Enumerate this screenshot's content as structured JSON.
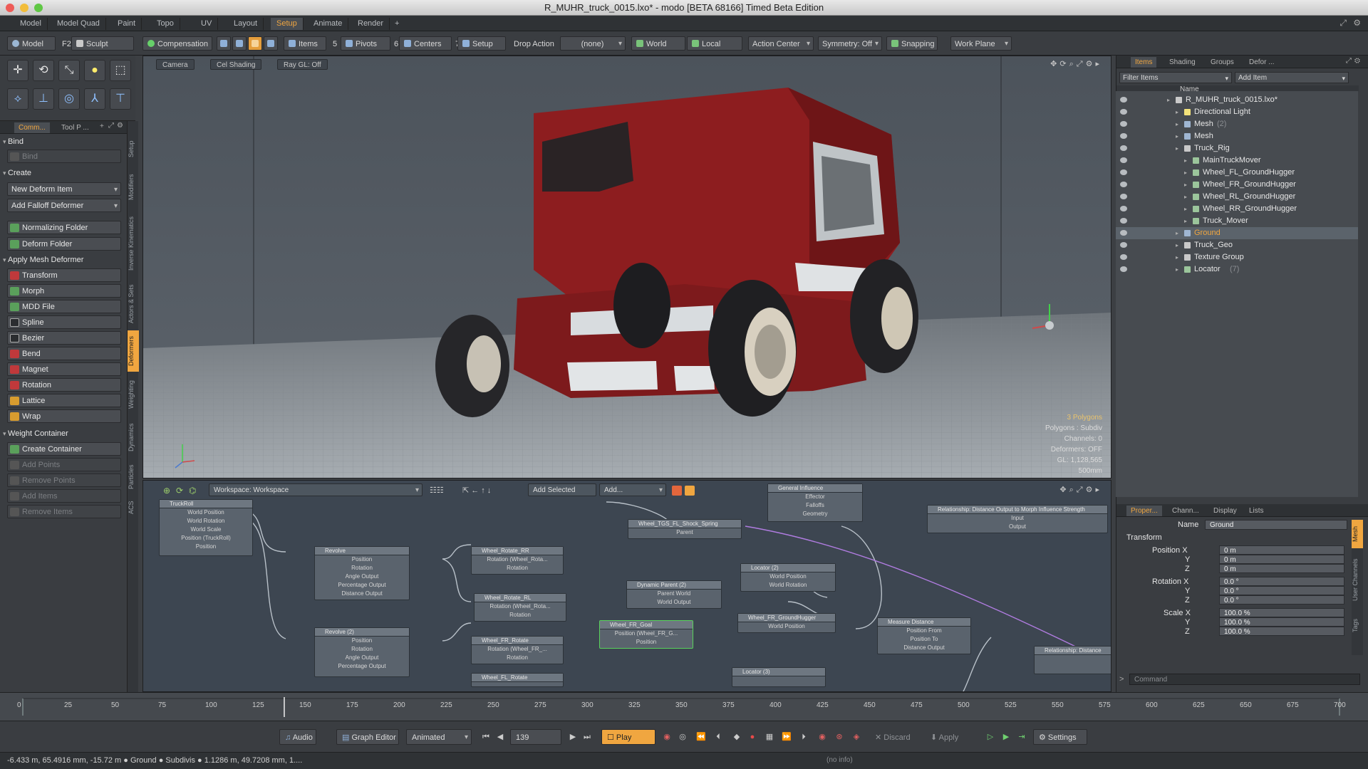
{
  "title": "R_MUHR_truck_0015.lxo* - modo [BETA 68166] Timed Beta Edition",
  "layout_tabs": [
    "Model",
    "Model Quad",
    "Paint",
    "Topo",
    "UV",
    "Layout",
    "Setup",
    "Animate",
    "Render",
    "+"
  ],
  "toolbar": {
    "model": "Model",
    "f2": "F2",
    "sculpt": "Sculpt",
    "compensation": "Compensation",
    "items": "Items",
    "n5": "5",
    "pivots": "Pivots",
    "n6": "6",
    "centers": "Centers",
    "n7": "7",
    "setup": "Setup",
    "drop_action": "Drop Action",
    "drop_value": "(none)",
    "world": "World",
    "local": "Local",
    "action_center": "Action Center",
    "symmetry": "Symmetry: Off",
    "snapping": "Snapping",
    "work_plane": "Work Plane"
  },
  "left_panel": {
    "tabs": [
      "Comm...",
      "Tool P ..."
    ],
    "bind_header": "Bind",
    "bind_btn": "Bind",
    "create_header": "Create",
    "new_deform": "New Deform Item",
    "add_falloff": "Add Falloff Deformer",
    "normalizing": "Normalizing Folder",
    "deform_folder": "Deform Folder",
    "apply_header": "Apply Mesh Deformer",
    "deformers": [
      "Transform",
      "Morph",
      "MDD File",
      "Spline",
      "Bezier",
      "Bend",
      "Magnet",
      "Rotation",
      "Lattice",
      "Wrap"
    ],
    "weight_header": "Weight Container",
    "create_container": "Create Container",
    "disabled": [
      "Add Points",
      "Remove Points",
      "Add Items",
      "Remove Items"
    ],
    "vtabs": [
      "Setup",
      "Modifiers",
      "Inverse Kinematics",
      "Actors & Sets",
      "Deformers",
      "Weighting",
      "Dynamics",
      "Particles",
      "ACS"
    ]
  },
  "viewport": {
    "tabs": [
      "Camera",
      "Cel Shading",
      "Ray GL: Off"
    ],
    "info": [
      "3 Polygons",
      "Polygons : Subdiv",
      "Channels: 0",
      "Deformers: OFF",
      "GL: 1,128,565",
      "500mm"
    ],
    "colors": {
      "body": "#8d1d1f",
      "body_dark": "#5a1012",
      "floor": "#8f959b",
      "sky": "#4b525a"
    }
  },
  "node_editor": {
    "workspace": "Workspace: Workspace",
    "add_selected": "Add Selected",
    "add": "Add...",
    "nodes": [
      {
        "title": "TruckRoll",
        "ports": [
          "World Position",
          "World Rotation",
          "World Scale",
          "Position (TruckRoll)",
          "Position"
        ]
      },
      {
        "title": "Revolve",
        "ports": [
          "Position",
          "Rotation",
          "Angle Output",
          "Percentage Output",
          "Distance Output"
        ]
      },
      {
        "title": "Revolve (2)",
        "ports": [
          "Position",
          "Rotation",
          "Angle Output",
          "Percentage Output"
        ]
      },
      {
        "title": "Wheel_Rotate_RR",
        "ports": [
          "Rotation (Wheel_Rota...",
          "Rotation"
        ]
      },
      {
        "title": "Wheel_Rotate_RL",
        "ports": [
          "Rotation (Wheel_Rota...",
          "Rotation"
        ]
      },
      {
        "title": "Wheel_FR_Rotate",
        "ports": [
          "Rotation (Wheel_FR_...",
          "Rotation"
        ]
      },
      {
        "title": "Wheel_FL_Rotate",
        "ports": []
      },
      {
        "title": "Wheel_TGS_FL_Shock_Spring",
        "ports": [
          "Parent"
        ]
      },
      {
        "title": "Dynamic Parent (2)",
        "ports": [
          "Parent World",
          "World Output"
        ]
      },
      {
        "title": "Wheel_FR_Goal",
        "ports": [
          "Position (Wheel_FR_G...",
          "Position"
        ]
      },
      {
        "title": "General Influence",
        "ports": [
          "Effector",
          "Falloffs",
          "Geometry"
        ]
      },
      {
        "title": "Locator (2)",
        "ports": [
          "World Position",
          "World Rotation"
        ]
      },
      {
        "title": "Wheel_FR_GroundHugger",
        "ports": [
          "World Position"
        ]
      },
      {
        "title": "Measure Distance",
        "ports": [
          "Position From",
          "Position To",
          "Distance Output"
        ]
      },
      {
        "title": "Relationship: Distance Output to Morph Influence Strength",
        "ports": [
          "Input",
          "Output"
        ]
      },
      {
        "title": "Relationship: Distance",
        "ports": []
      },
      {
        "title": "Locator (3)",
        "ports": []
      }
    ]
  },
  "right_panel": {
    "tabs": [
      "Items",
      "Shading",
      "Groups",
      "Defor ..."
    ],
    "filter": "Filter Items",
    "add_item": "Add Item",
    "col_name": "Name",
    "items": [
      {
        "label": "R_MUHR_truck_0015.lxo*",
        "indent": 0,
        "icon": "scene"
      },
      {
        "label": "Directional Light",
        "indent": 1,
        "icon": "light"
      },
      {
        "label": "Mesh",
        "count": "(2)",
        "indent": 1,
        "icon": "mesh"
      },
      {
        "label": "Mesh",
        "indent": 1,
        "icon": "mesh"
      },
      {
        "label": "Truck_Rig",
        "indent": 1,
        "icon": "group"
      },
      {
        "label": "MainTruckMover",
        "indent": 2,
        "icon": "locator"
      },
      {
        "label": "Wheel_FL_GroundHugger",
        "indent": 2,
        "icon": "locator"
      },
      {
        "label": "Wheel_FR_GroundHugger",
        "indent": 2,
        "icon": "locator"
      },
      {
        "label": "Wheel_RL_GroundHugger",
        "indent": 2,
        "icon": "locator"
      },
      {
        "label": "Wheel_RR_GroundHugger",
        "indent": 2,
        "icon": "locator"
      },
      {
        "label": "Truck_Mover",
        "indent": 2,
        "icon": "locator"
      },
      {
        "label": "Ground",
        "indent": 1,
        "icon": "mesh",
        "selected": true
      },
      {
        "label": "Truck_Geo",
        "indent": 1,
        "icon": "group"
      },
      {
        "label": "Texture Group",
        "indent": 1,
        "icon": "group"
      },
      {
        "label": "Locator",
        "count": "(7)",
        "indent": 1,
        "icon": "locator"
      }
    ],
    "prop_tabs": [
      "Proper...",
      "Chann...",
      "Display",
      "Lists"
    ],
    "name_label": "Name",
    "name_value": "Ground",
    "transform": "Transform",
    "position_label": "Position X",
    "rotation_label": "Rotation X",
    "scale_label": "Scale X",
    "y": "Y",
    "z": "Z",
    "position": [
      "0 m",
      "0 m",
      "0 m"
    ],
    "rotation": [
      "0.0 °",
      "0.0 °",
      "0.0 °"
    ],
    "scale": [
      "100.0 %",
      "100.0 %",
      "100.0 %"
    ],
    "side_tabs": [
      "Mesh",
      "User Channels",
      "Tags"
    ],
    "command": "Command"
  },
  "timeline": {
    "ticks": [
      "0",
      "25",
      "50",
      "75",
      "100",
      "125",
      "150",
      "175",
      "200",
      "225",
      "250",
      "275",
      "300",
      "325",
      "350",
      "375",
      "400",
      "425",
      "450",
      "475",
      "500",
      "525",
      "550",
      "575",
      "600",
      "625",
      "650",
      "675",
      "700"
    ],
    "start": "0",
    "end": "700",
    "current_frame": 139,
    "range_start": "0",
    "range_end": "700"
  },
  "transport": {
    "audio": "Audio",
    "graph_editor": "Graph Editor",
    "animated": "Animated",
    "frame": "139",
    "play": "Play",
    "discard": "Discard",
    "apply": "Apply",
    "settings": "Settings"
  },
  "status": {
    "text": "-6.433 m, 65.4916 mm, -15.72 m ● Ground ● Subdivis ● 1.1286 m, 49.7208 mm, 1....",
    "info": "(no info)"
  }
}
